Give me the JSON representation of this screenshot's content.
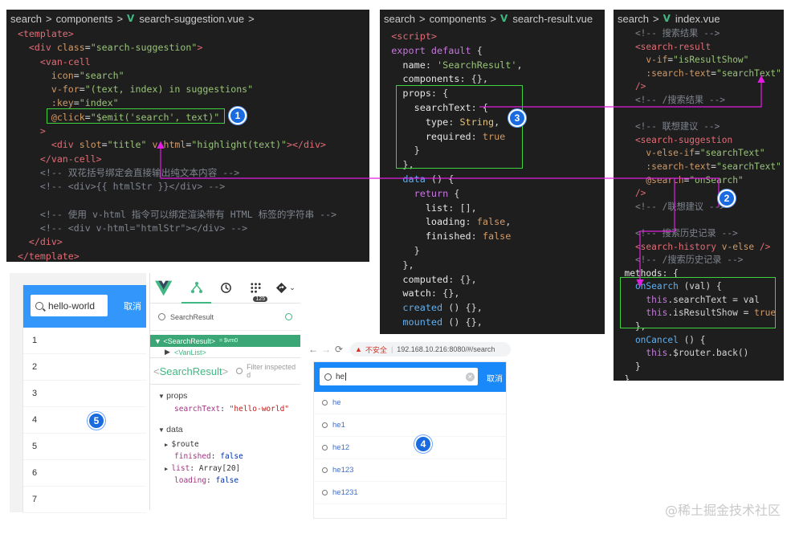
{
  "panel1": {
    "crumb": [
      "search",
      "components",
      "search-suggestion.vue"
    ],
    "lines": [
      [
        [
          "t-tag",
          "  <template>"
        ]
      ],
      [
        [
          "t-tag",
          "    <div "
        ],
        [
          "t-attr",
          "class"
        ],
        [
          "t-txt",
          "="
        ],
        [
          "t-str",
          "\"search-suggestion\""
        ],
        [
          "t-tag",
          ">"
        ]
      ],
      [
        [
          "t-tag",
          "      <van-cell"
        ]
      ],
      [
        [
          "t-attr",
          "        icon"
        ],
        [
          "t-txt",
          "="
        ],
        [
          "t-str",
          "\"search\""
        ]
      ],
      [
        [
          "t-attr",
          "        v-for"
        ],
        [
          "t-txt",
          "="
        ],
        [
          "t-str",
          "\"(text, index) in suggestions\""
        ]
      ],
      [
        [
          "t-attr",
          "        :key"
        ],
        [
          "t-txt",
          "="
        ],
        [
          "t-str",
          "\"index\""
        ]
      ],
      [
        [
          "t-attr",
          "        @click"
        ],
        [
          "t-txt",
          "="
        ],
        [
          "t-str",
          "\"$emit('search', text)\""
        ]
      ],
      [
        [
          "t-tag",
          "      >"
        ]
      ],
      [
        [
          "t-tag",
          "        <div "
        ],
        [
          "t-attr",
          "slot"
        ],
        [
          "t-txt",
          "="
        ],
        [
          "t-str",
          "\"title\" "
        ],
        [
          "t-attr",
          "v-html"
        ],
        [
          "t-txt",
          "="
        ],
        [
          "t-str",
          "\"highlight(text)\""
        ],
        [
          "t-tag",
          "></div>"
        ]
      ],
      [
        [
          "t-tag",
          "      </van-cell>"
        ]
      ],
      [
        [
          "t-cm",
          "      <!-- 双花括号绑定会直接输出纯文本内容 -->"
        ]
      ],
      [
        [
          "t-cm",
          "      <!-- <div>{{ htmlStr }}</div> -->"
        ]
      ],
      [
        [
          "t-txt",
          " "
        ]
      ],
      [
        [
          "t-cm",
          "      <!-- 使用 v-html 指令可以绑定渲染带有 HTML 标签的字符串 -->"
        ]
      ],
      [
        [
          "t-cm",
          "      <!-- <div v-html=\"htmlStr\"></div> -->"
        ]
      ],
      [
        [
          "t-tag",
          "    </div>"
        ]
      ],
      [
        [
          "t-tag",
          "  </template>"
        ]
      ]
    ]
  },
  "panel3": {
    "crumb": [
      "search",
      "components",
      "search-result.vue"
    ],
    "lines": [
      [
        [
          "t-tag",
          "  <script>"
        ]
      ],
      [
        [
          "t-kw",
          "  export default"
        ],
        [
          "t-txt",
          " {"
        ]
      ],
      [
        [
          "t-key",
          "    name"
        ],
        [
          "t-txt",
          ": "
        ],
        [
          "t-str",
          "'SearchResult'"
        ],
        [
          "t-txt",
          ","
        ]
      ],
      [
        [
          "t-key",
          "    components"
        ],
        [
          "t-txt",
          ": {},"
        ]
      ],
      [
        [
          "t-key",
          "    props"
        ],
        [
          "t-txt",
          ": {"
        ]
      ],
      [
        [
          "t-key",
          "      searchText"
        ],
        [
          "t-txt",
          ": {"
        ]
      ],
      [
        [
          "t-key",
          "        type"
        ],
        [
          "t-txt",
          ": "
        ],
        [
          "t-type",
          "String"
        ],
        [
          "t-txt",
          ","
        ]
      ],
      [
        [
          "t-key",
          "        required"
        ],
        [
          "t-txt",
          ": "
        ],
        [
          "t-num",
          "true"
        ]
      ],
      [
        [
          "t-txt",
          "      }"
        ]
      ],
      [
        [
          "t-txt",
          "    },"
        ]
      ],
      [
        [
          "t-fn",
          "    data"
        ],
        [
          "t-txt",
          " () {"
        ]
      ],
      [
        [
          "t-kw",
          "      return"
        ],
        [
          "t-txt",
          " {"
        ]
      ],
      [
        [
          "t-key",
          "        list"
        ],
        [
          "t-txt",
          ": [],"
        ]
      ],
      [
        [
          "t-key",
          "        loading"
        ],
        [
          "t-txt",
          ": "
        ],
        [
          "t-num",
          "false"
        ],
        [
          "t-txt",
          ","
        ]
      ],
      [
        [
          "t-key",
          "        finished"
        ],
        [
          "t-txt",
          ": "
        ],
        [
          "t-num",
          "false"
        ]
      ],
      [
        [
          "t-txt",
          "      }"
        ]
      ],
      [
        [
          "t-txt",
          "    },"
        ]
      ],
      [
        [
          "t-key",
          "    computed"
        ],
        [
          "t-txt",
          ": {},"
        ]
      ],
      [
        [
          "t-key",
          "    watch"
        ],
        [
          "t-txt",
          ": {},"
        ]
      ],
      [
        [
          "t-fn",
          "    created"
        ],
        [
          "t-txt",
          " () {},"
        ]
      ],
      [
        [
          "t-fn",
          "    mounted"
        ],
        [
          "t-txt",
          " () {},"
        ]
      ]
    ]
  },
  "panel2": {
    "crumb": [
      "search",
      "index.vue"
    ],
    "lines": [
      [
        [
          "t-cm",
          "    <!-- 搜索结果 -->"
        ]
      ],
      [
        [
          "t-tag",
          "    <search-result"
        ]
      ],
      [
        [
          "t-attr",
          "      v-if"
        ],
        [
          "t-txt",
          "="
        ],
        [
          "t-str",
          "\"isResultShow\""
        ]
      ],
      [
        [
          "t-attr",
          "      :search-text"
        ],
        [
          "t-txt",
          "="
        ],
        [
          "t-str",
          "\"searchText\""
        ]
      ],
      [
        [
          "t-tag",
          "    />"
        ]
      ],
      [
        [
          "t-cm",
          "    <!-- /搜索结果 -->"
        ]
      ],
      [
        [
          "t-txt",
          " "
        ]
      ],
      [
        [
          "t-cm",
          "    <!-- 联想建议 -->"
        ]
      ],
      [
        [
          "t-tag",
          "    <search-suggestion"
        ]
      ],
      [
        [
          "t-attr",
          "      v-else-if"
        ],
        [
          "t-txt",
          "="
        ],
        [
          "t-str",
          "\"searchText\""
        ]
      ],
      [
        [
          "t-attr",
          "      :search-text"
        ],
        [
          "t-txt",
          "="
        ],
        [
          "t-str",
          "\"searchText\""
        ]
      ],
      [
        [
          "t-attr",
          "      @search"
        ],
        [
          "t-txt",
          "="
        ],
        [
          "t-str",
          "\"onSearch\""
        ]
      ],
      [
        [
          "t-tag",
          "    />"
        ]
      ],
      [
        [
          "t-cm",
          "    <!-- /联想建议 -->"
        ]
      ],
      [
        [
          "t-txt",
          " "
        ]
      ],
      [
        [
          "t-cm",
          "    <!-- 搜索历史记录 -->"
        ]
      ],
      [
        [
          "t-tag",
          "    <search-history "
        ],
        [
          "t-attr",
          "v-else"
        ],
        [
          "t-tag",
          " />"
        ]
      ],
      [
        [
          "t-cm",
          "    <!-- /搜索历史记录 -->"
        ]
      ],
      [
        [
          "t-key",
          "  methods"
        ],
        [
          "t-txt",
          ": {"
        ]
      ],
      [
        [
          "t-fn",
          "    onSearch"
        ],
        [
          "t-txt",
          " (val) {"
        ]
      ],
      [
        [
          "t-kw",
          "      this"
        ],
        [
          "t-txt",
          ".searchText = val"
        ]
      ],
      [
        [
          "t-kw",
          "      this"
        ],
        [
          "t-txt",
          ".isResultShow = "
        ],
        [
          "t-num",
          "true"
        ]
      ],
      [
        [
          "t-txt",
          "    },"
        ]
      ],
      [
        [
          "t-fn",
          "    onCancel"
        ],
        [
          "t-txt",
          " () {"
        ]
      ],
      [
        [
          "t-kw",
          "      this"
        ],
        [
          "t-txt",
          ".$router.back()"
        ]
      ],
      [
        [
          "t-txt",
          "    }"
        ]
      ],
      [
        [
          "t-txt",
          "  }"
        ]
      ]
    ]
  },
  "badges": [
    "1",
    "2",
    "3",
    "4",
    "5"
  ],
  "phone": {
    "search_value": "hello-world",
    "cancel": "取消",
    "items": [
      "1",
      "2",
      "3",
      "4",
      "5",
      "6",
      "7"
    ]
  },
  "devtools": {
    "badge_count": "125",
    "search_placeholder": "SearchResult",
    "selected": "<SearchResult>",
    "selected_chip": "= $vm0",
    "child": "<VanList>",
    "component": "SearchResult",
    "filter_placeholder": "Filter inspected d",
    "props_label": "props",
    "prop_key": "searchText",
    "prop_val": "\"hello-world\"",
    "data_label": "data",
    "data_rows": [
      {
        "key": "$route",
        "val": ""
      },
      {
        "key": "finished",
        "val": "false"
      },
      {
        "key": "list",
        "val": "Array[20]"
      },
      {
        "key": "loading",
        "val": "false"
      }
    ]
  },
  "browser": {
    "insecure": "不安全",
    "url": "192.168.10.216:8080/#/search",
    "query": "he",
    "cancel": "取消",
    "suggestions": [
      "he",
      "he1",
      "he12",
      "he123",
      "he1231"
    ]
  },
  "watermark": "@稀土掘金技术社区",
  "colors": {
    "editor_bg": "#1e1e1e",
    "highlight_box": "#3fd13f",
    "arrow": "#e01ee0",
    "badge": "#1a6ae0",
    "vue_green": "#41b883",
    "van_blue": "#1989fa"
  }
}
